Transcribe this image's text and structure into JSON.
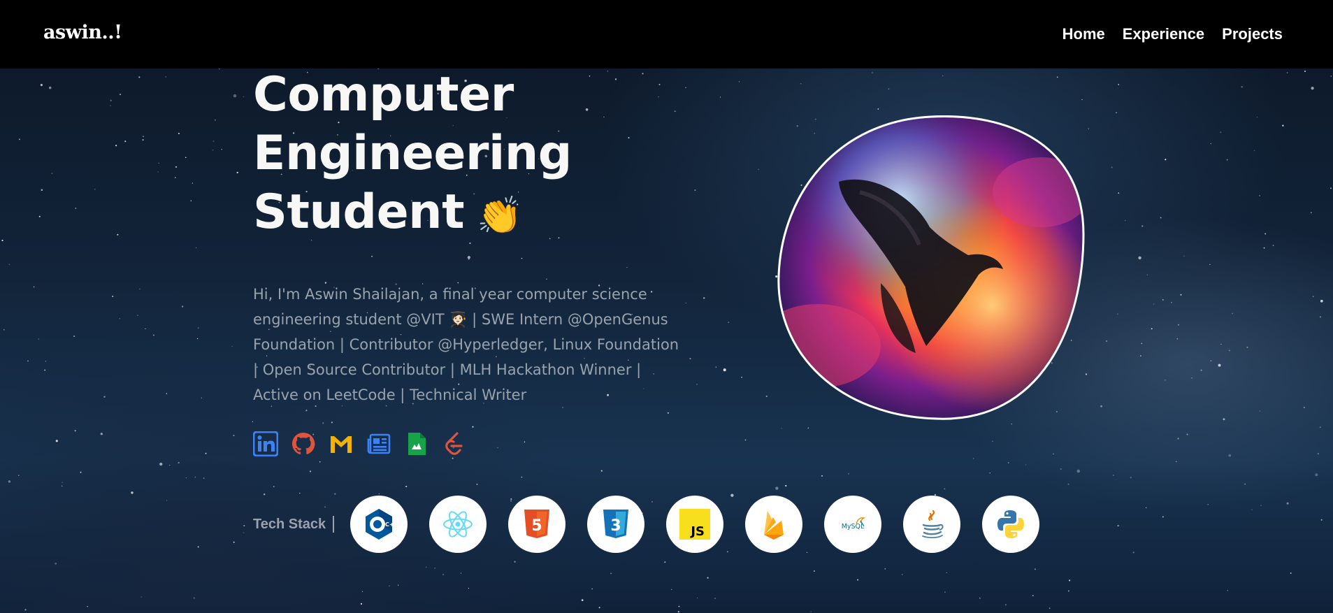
{
  "nav": {
    "brand": "aswin..!",
    "links": [
      "Home",
      "Experience",
      "Projects"
    ]
  },
  "hero": {
    "title_lines": [
      "Computer",
      "Engineering",
      "Student"
    ],
    "title_emoji": "👏",
    "bio": "Hi, I'm Aswin Shailajan, a final year computer science engineering student @VIT 🧑🏻‍🎓 | SWE Intern @OpenGenus Foundation | Contributor @Hyperledger, Linux Foundation | Open Source Contributor | MLH Hackathon Winner | Active on LeetCode | Technical Writer"
  },
  "socials": [
    {
      "icon": "linkedin-icon",
      "color": "#3b82f6"
    },
    {
      "icon": "github-icon",
      "color": "#e0533d"
    },
    {
      "icon": "gmail-icon",
      "color": "#f5b301"
    },
    {
      "icon": "newspaper-icon",
      "color": "#3b82f6"
    },
    {
      "icon": "resume-file-icon",
      "color": "#16a34a"
    },
    {
      "icon": "leetcode-icon",
      "color": "#e0533d"
    }
  ],
  "tech_stack": {
    "label": "Tech Stack",
    "items": [
      {
        "icon": "cpp-icon",
        "text": "C++",
        "color": "#00599c"
      },
      {
        "icon": "react-icon",
        "color": "#61dafb"
      },
      {
        "icon": "html5-icon",
        "text": "5",
        "color": "#e44d26"
      },
      {
        "icon": "css3-icon",
        "text": "3",
        "color": "#1572b6"
      },
      {
        "icon": "javascript-icon",
        "text": "JS",
        "color": "#f7df1e"
      },
      {
        "icon": "firebase-icon",
        "color": "#ffa000"
      },
      {
        "icon": "mysql-icon",
        "text": "MySQL",
        "color": "#00758f"
      },
      {
        "icon": "java-icon",
        "color": "#e76f00"
      },
      {
        "icon": "python-icon",
        "color": "#3776ab"
      }
    ]
  },
  "colors": {
    "navbar_bg": "#000000",
    "title": "#f7f7f5",
    "body_text": "#9aa3ad",
    "background": "#12243a"
  }
}
